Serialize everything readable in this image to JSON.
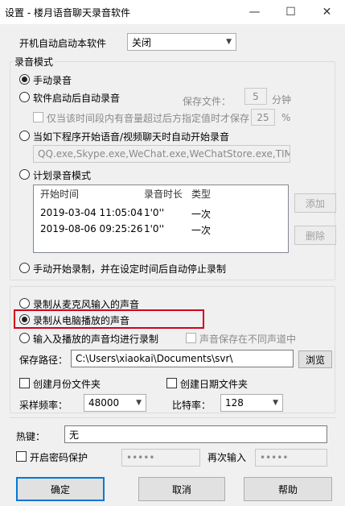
{
  "window": {
    "title": "设置 - 楼月语音聊天录音软件",
    "minimize": "—",
    "maximize": "☐",
    "close": "✕"
  },
  "autostart": {
    "label": "开机自动启动本软件",
    "value": "关闭"
  },
  "record_mode": {
    "group_title": "录音模式",
    "manual": "手动录音",
    "auto_on_start": "软件启动后自动录音",
    "save_file_label": "保存文件：",
    "save_file_minutes": "5",
    "minutes_unit": "分钟",
    "only_volume_label": "仅当该时间段内有音量超过后方指定值时才保存",
    "volume_threshold": "25",
    "percent": "%",
    "auto_programs": "当如下程序开始语音/视频聊天时自动开始录音",
    "programs_value": "QQ.exe,Skype.exe,WeChat.exe,WeChatStore.exe,TIM.exe",
    "scheduled": "计划录音模式",
    "table": {
      "headers": [
        "开始时间",
        "录音时长",
        "类型"
      ],
      "rows": [
        [
          "2019-03-04 11:05:04",
          "1'0''",
          "一次"
        ],
        [
          "2019-08-06 09:25:26",
          "1'0''",
          "一次"
        ]
      ]
    },
    "add": "添加",
    "delete": "删除",
    "manual_timed": "手动开始录制，并在设定时间后自动停止录制"
  },
  "source": {
    "mic": "录制从麦克风输入的声音",
    "speaker": "录制从电脑播放的声音",
    "both": "输入及播放的声音均进行录制",
    "separate_channels": "声音保存在不同声道中"
  },
  "save": {
    "path_label": "保存路径：",
    "path_value": "C:\\Users\\xiaokai\\Documents\\svr\\",
    "browse": "浏览",
    "monthly_folder": "创建月份文件夹",
    "date_folder": "创建日期文件夹",
    "sample_rate_label": "采样频率：",
    "sample_rate": "48000",
    "bitrate_label": "比特率：",
    "bitrate": "128"
  },
  "hotkey": {
    "label": "热键：",
    "value": "无"
  },
  "password": {
    "label": "开启密码保护",
    "value": "•••••",
    "again_label": "再次输入",
    "again_value": "•••••"
  },
  "footer": {
    "ok": "确定",
    "cancel": "取消",
    "help": "帮助"
  },
  "colors": {
    "highlight": "#d0021b",
    "default_button_border": "#0078d7"
  }
}
